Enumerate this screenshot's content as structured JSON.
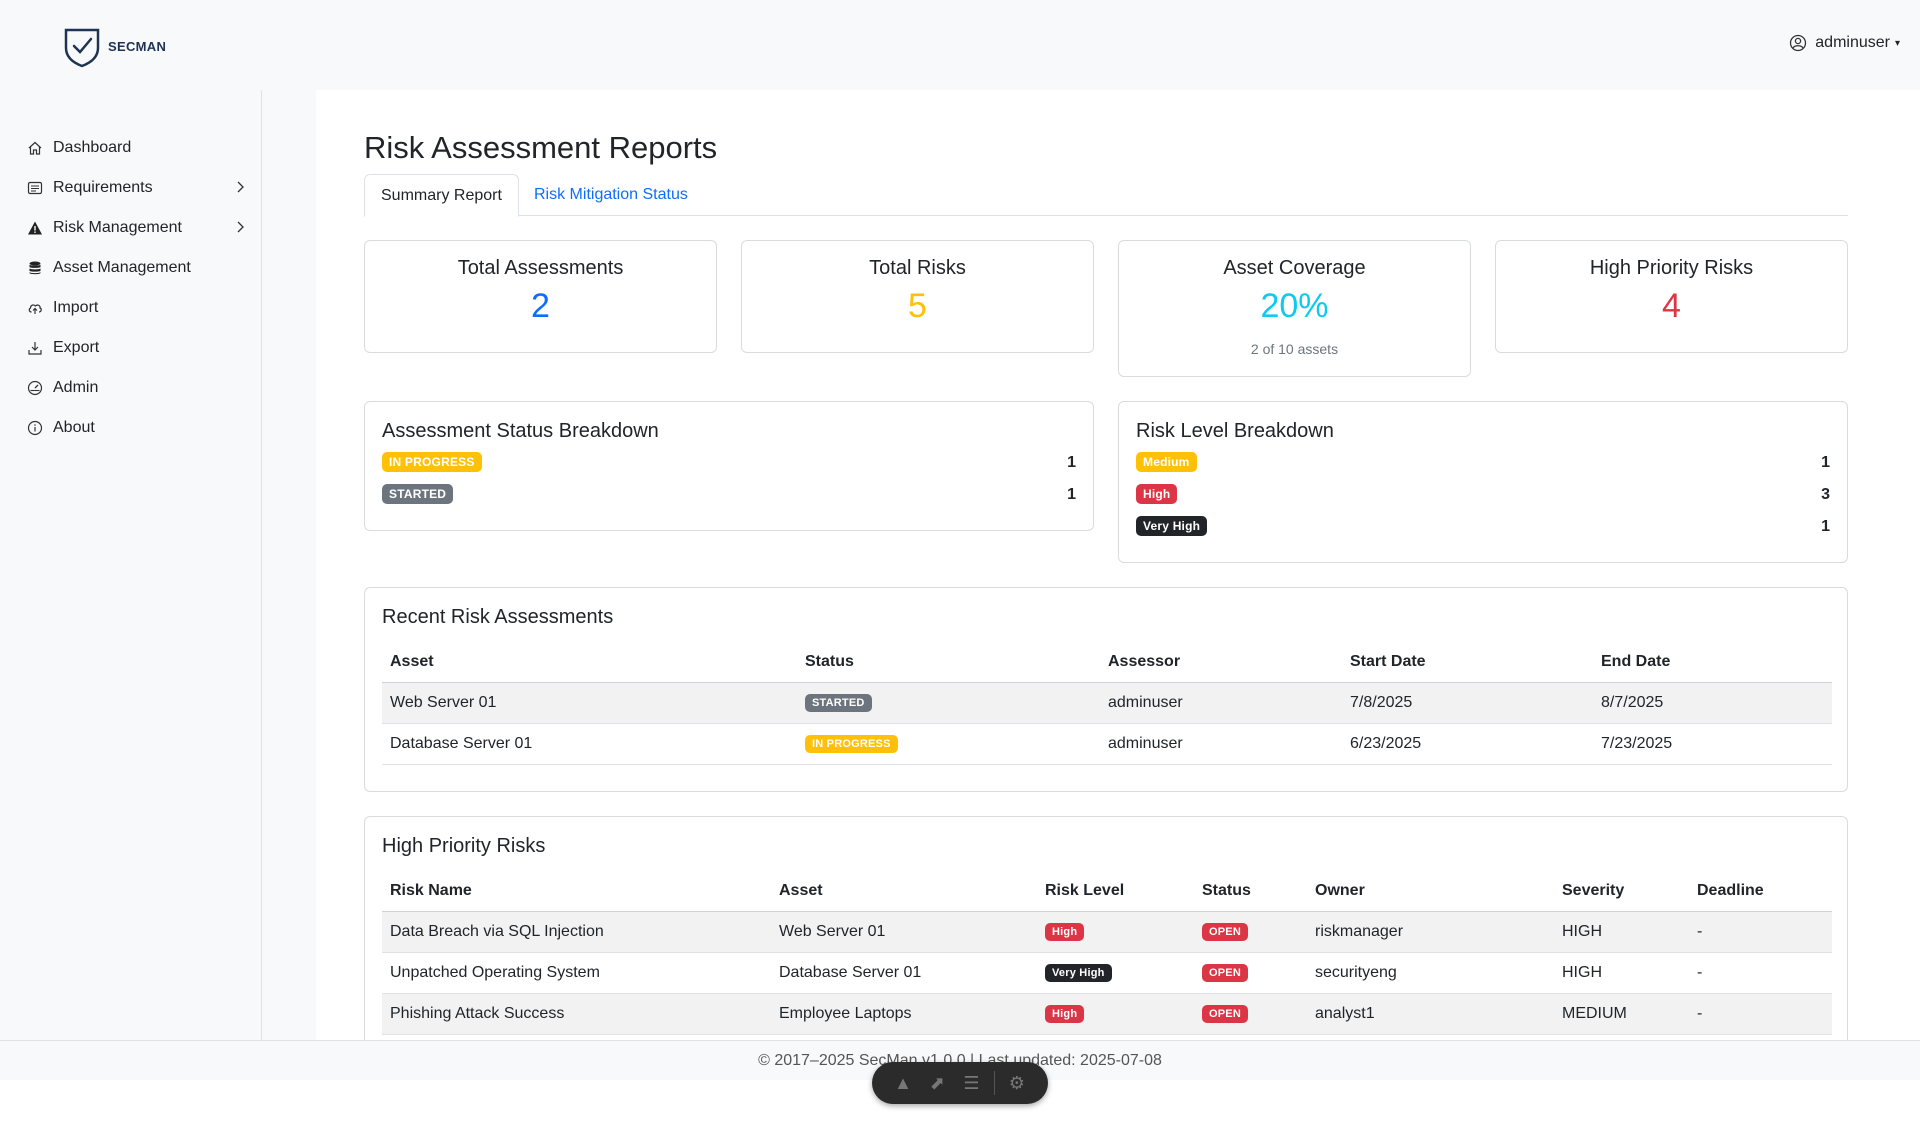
{
  "brand": {
    "logo_text": "SECMAN"
  },
  "user": {
    "name": "adminuser"
  },
  "sidebar": {
    "items": [
      {
        "label": "Dashboard",
        "icon": "house-icon"
      },
      {
        "label": "Requirements",
        "icon": "list-icon",
        "expandable": true
      },
      {
        "label": "Risk Management",
        "icon": "warning-icon",
        "expandable": true
      },
      {
        "label": "Asset Management",
        "icon": "database-icon"
      },
      {
        "label": "Import",
        "icon": "cloud-upload-icon"
      },
      {
        "label": "Export",
        "icon": "download-icon"
      },
      {
        "label": "Admin",
        "icon": "gauge-icon"
      },
      {
        "label": "About",
        "icon": "info-icon"
      }
    ]
  },
  "page": {
    "title": "Risk Assessment Reports",
    "tabs": [
      {
        "label": "Summary Report",
        "active": true
      },
      {
        "label": "Risk Mitigation Status",
        "active": false
      }
    ]
  },
  "stats": [
    {
      "title": "Total Assessments",
      "value": "2",
      "color": "#0d6efd"
    },
    {
      "title": "Total Risks",
      "value": "5",
      "color": "#ffc107"
    },
    {
      "title": "Asset Coverage",
      "value": "20%",
      "sub": "2 of 10 assets",
      "color": "#0dcaf0"
    },
    {
      "title": "High Priority Risks",
      "value": "4",
      "color": "#dc3545"
    }
  ],
  "assessment_status": {
    "title": "Assessment Status Breakdown",
    "rows": [
      {
        "label": "IN PROGRESS",
        "count": "1",
        "color": "#ffc107"
      },
      {
        "label": "STARTED",
        "count": "1",
        "color": "#6c757d"
      }
    ]
  },
  "risk_levels": {
    "title": "Risk Level Breakdown",
    "rows": [
      {
        "label": "Medium",
        "count": "1",
        "color": "#ffc107"
      },
      {
        "label": "High",
        "count": "3",
        "color": "#dc3545"
      },
      {
        "label": "Very High",
        "count": "1",
        "color": "#212529"
      }
    ]
  },
  "recent": {
    "title": "Recent Risk Assessments",
    "headers": [
      "Asset",
      "Status",
      "Assessor",
      "Start Date",
      "End Date"
    ],
    "rows": [
      {
        "asset": "Web Server 01",
        "status": "STARTED",
        "assessor": "adminuser",
        "start": "7/8/2025",
        "end": "8/7/2025"
      },
      {
        "asset": "Database Server 01",
        "status": "IN PROGRESS",
        "assessor": "adminuser",
        "start": "6/23/2025",
        "end": "7/23/2025"
      }
    ]
  },
  "high_priority": {
    "title": "High Priority Risks",
    "headers": [
      "Risk Name",
      "Asset",
      "Risk Level",
      "Status",
      "Owner",
      "Severity",
      "Deadline"
    ],
    "rows": [
      {
        "name": "Data Breach via SQL Injection",
        "asset": "Web Server 01",
        "level": "High",
        "status": "OPEN",
        "owner": "riskmanager",
        "severity": "HIGH",
        "deadline": "-"
      },
      {
        "name": "Unpatched Operating System",
        "asset": "Database Server 01",
        "level": "Very High",
        "status": "OPEN",
        "owner": "securityeng",
        "severity": "HIGH",
        "deadline": "-"
      },
      {
        "name": "Phishing Attack Success",
        "asset": "Employee Laptops",
        "level": "High",
        "status": "OPEN",
        "owner": "analyst1",
        "severity": "MEDIUM",
        "deadline": "-"
      }
    ]
  },
  "footer": {
    "text": "© 2017–2025 SecMan v1.0.0 | Last updated: 2025-07-08"
  }
}
